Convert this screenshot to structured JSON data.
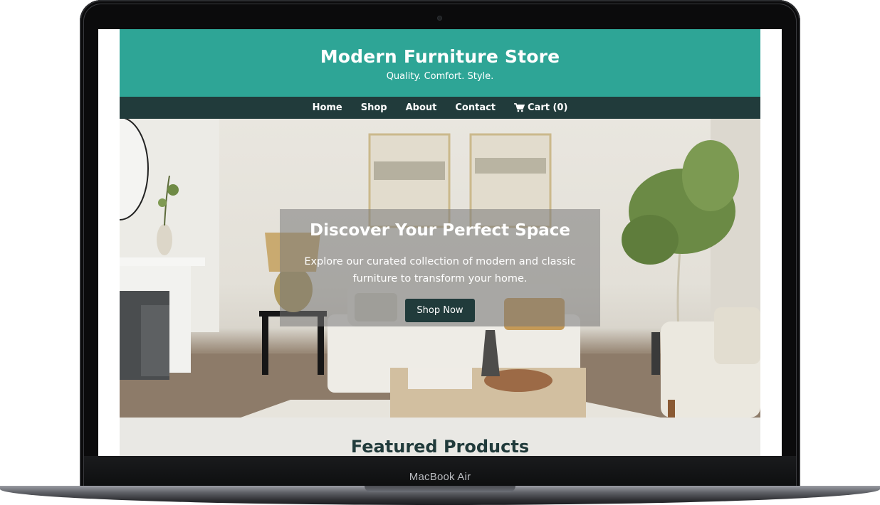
{
  "site": {
    "title": "Modern Furniture Store",
    "tagline": "Quality. Comfort. Style.",
    "primary_color": "#2ea596",
    "nav_color": "#213b3b"
  },
  "nav": {
    "items": [
      {
        "label": "Home"
      },
      {
        "label": "Shop"
      },
      {
        "label": "About"
      },
      {
        "label": "Contact"
      }
    ],
    "cart_label": "Cart (0)",
    "cart_icon": "shopping-cart-icon"
  },
  "hero": {
    "title": "Discover Your Perfect Space",
    "text": "Explore our curated collection of modern and classic furniture to transform your home.",
    "button_label": "Shop Now"
  },
  "featured": {
    "title": "Featured Products"
  },
  "device": {
    "label": "MacBook Air"
  }
}
